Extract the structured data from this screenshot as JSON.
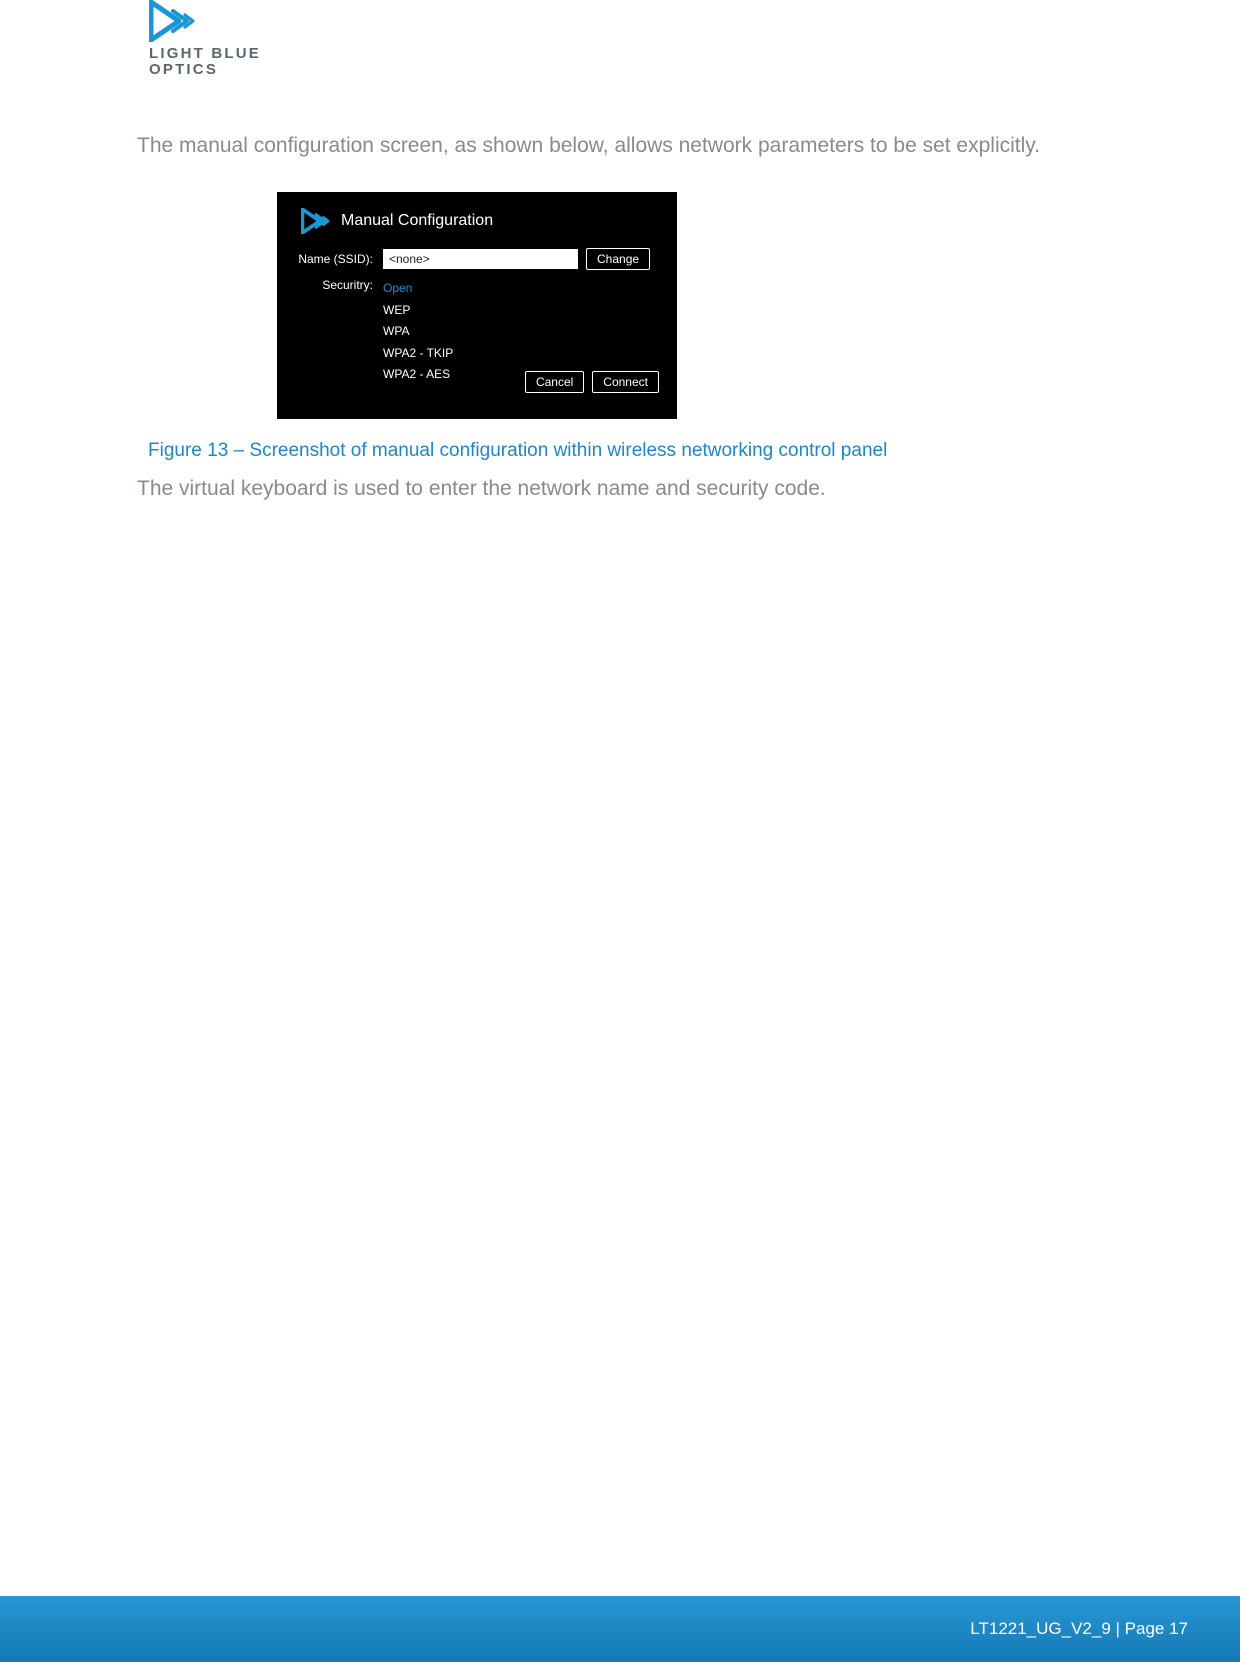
{
  "logo": {
    "line1": "LIGHT BLUE",
    "line2": "OPTICS"
  },
  "intro_paragraph": "The manual configuration screen, as shown below, allows network parameters to be set explicitly.",
  "screenshot": {
    "title": "Manual Configuration",
    "ssid_label": "Name (SSID):",
    "ssid_value": "<none>",
    "change_button": "Change",
    "security_label": "Securitry:",
    "security_options": [
      "Open",
      "WEP",
      "WPA",
      "WPA2 - TKIP",
      "WPA2 - AES"
    ],
    "security_selected_index": 0,
    "cancel_button": "Cancel",
    "connect_button": "Connect"
  },
  "figure_caption": "Figure 13 – Screenshot of manual configuration within wireless networking control panel",
  "followup_paragraph": "The virtual keyboard is used to enter the network name and security code.",
  "footer": "LT1221_UG_V2_9 | Page 17"
}
